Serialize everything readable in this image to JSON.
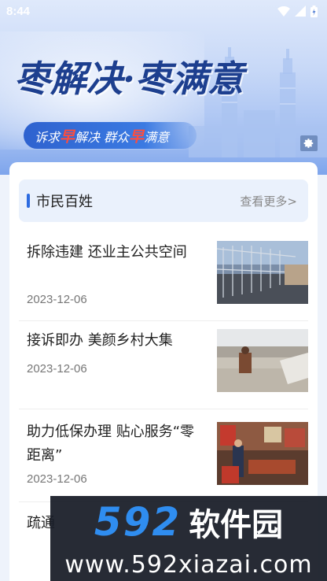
{
  "status_bar": {
    "time": "8:44"
  },
  "banner": {
    "title": "枣解决·枣满意",
    "subtitle_parts": [
      "诉求",
      "早",
      "解决  群众",
      "早",
      "满意"
    ]
  },
  "section": {
    "title": "市民百姓",
    "more": "查看更多>"
  },
  "news": [
    {
      "title": "拆除违建  还业主公共空间",
      "date": "2023-12-06"
    },
    {
      "title": "接诉即办  美颜乡村大集",
      "date": "2023-12-06"
    },
    {
      "title": "助力低保办理  贴心服务“零距离”",
      "date": "2023-12-06"
    },
    {
      "title": "疏通",
      "date": ""
    }
  ],
  "watermark": {
    "logo_num": "592",
    "logo_cn": "软件园",
    "url": "www.592xiazai.com"
  },
  "colors": {
    "accent": "#2c6be0",
    "banner_title": "#1d3f8f",
    "highlight": "#ff4d3d"
  }
}
